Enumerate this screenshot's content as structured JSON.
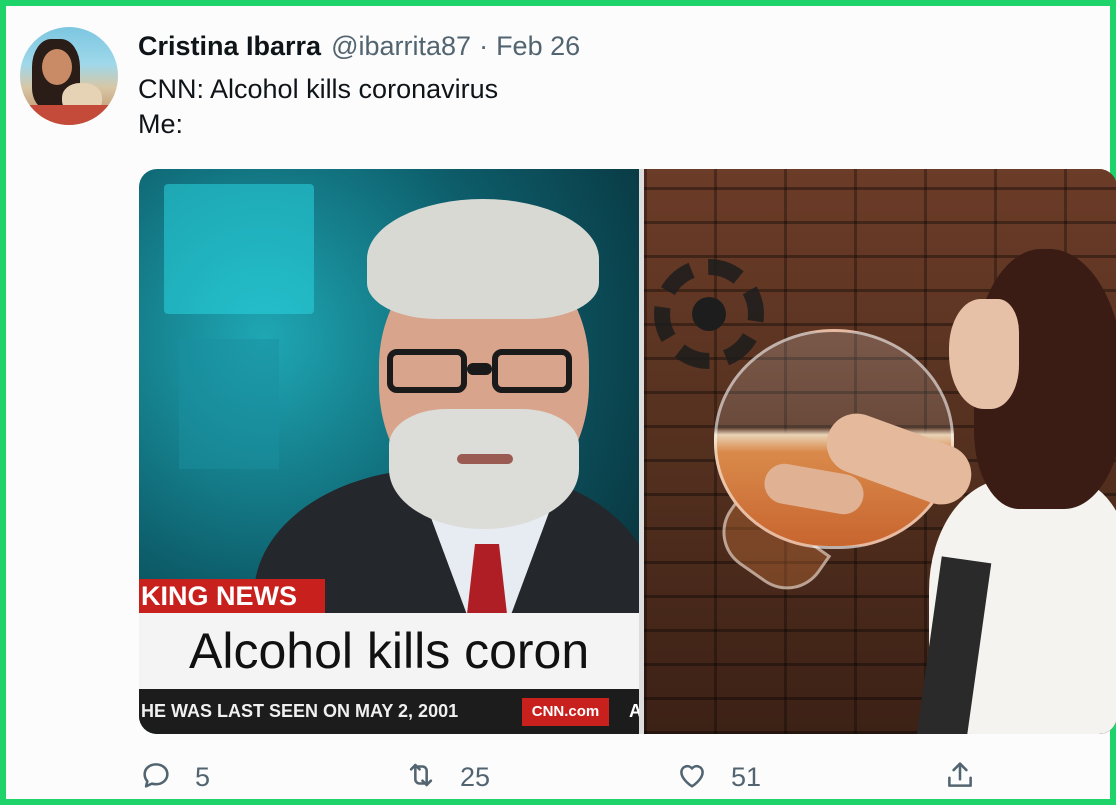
{
  "tweet": {
    "display_name": "Cristina Ibarra",
    "handle": "@ibarrita87",
    "separator": "·",
    "date": "Feb 26",
    "text_line1": "CNN: Alcohol kills coronavirus",
    "text_line2": "Me:"
  },
  "media": {
    "left_image": {
      "breaking_label": "KING NEWS",
      "headline": "Alcohol kills coron",
      "ticker": "HE WAS LAST SEEN ON MAY 2, 2001",
      "logo": "CNN.com",
      "ticker_end": "A"
    }
  },
  "actions": {
    "reply_count": "5",
    "retweet_count": "25",
    "like_count": "51"
  },
  "icons": {
    "reply": "reply-icon",
    "retweet": "retweet-icon",
    "like": "heart-icon",
    "share": "share-icon"
  },
  "colors": {
    "border": "#1fd36b",
    "secondary_text": "#536471",
    "cnn_red": "#c8211d"
  }
}
